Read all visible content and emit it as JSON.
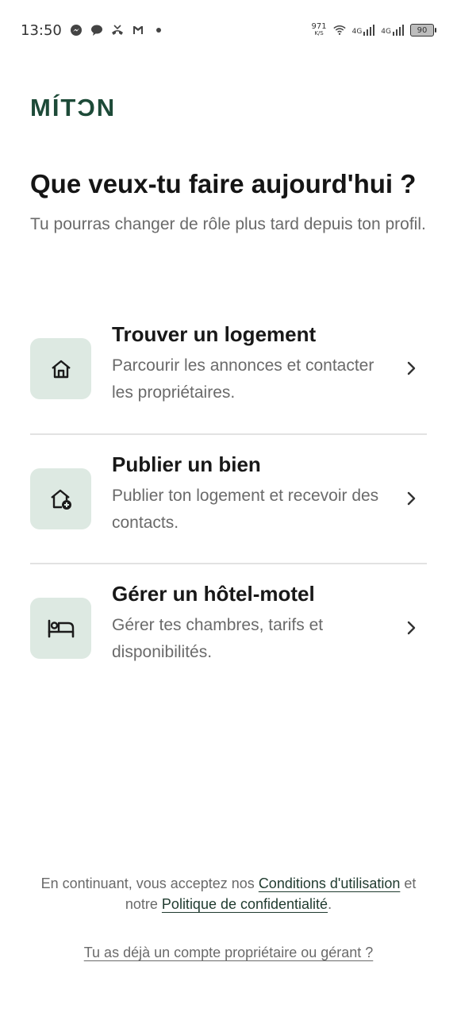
{
  "status_bar": {
    "time": "13:50",
    "speed_value": "971",
    "speed_unit": "K/S",
    "net1": "4G",
    "net2": "4G",
    "battery": "90",
    "notification_icons": [
      "messenger-icon",
      "chat-icon",
      "missed-call-icon",
      "gmail-icon",
      "dot-icon"
    ]
  },
  "brand": {
    "logo": "MÍTƆN",
    "color": "#1d4a38"
  },
  "heading": {
    "title": "Que veux-tu faire aujourd'hui ?",
    "subtitle": "Tu pourras changer de rôle plus tard depuis ton profil."
  },
  "options": [
    {
      "title": "Trouver un logement",
      "description": "Parcourir les annonces et contacter les propriétaires.",
      "icon": "home-icon"
    },
    {
      "title": "Publier un bien",
      "description": "Publier ton logement et recevoir des contacts.",
      "icon": "home-add-icon"
    },
    {
      "title": "Gérer un hôtel-motel",
      "description": "Gérer tes chambres, tarifs et disponibilités.",
      "icon": "bed-icon"
    }
  ],
  "legal": {
    "prefix": "En continuant, vous acceptez nos ",
    "terms_link": "Conditions d'utilisation",
    "middle": " et notre ",
    "privacy_link": "Politique de confidentialité",
    "suffix": "."
  },
  "login_link": "Tu as déjà un compte propriétaire ou gérant ?"
}
